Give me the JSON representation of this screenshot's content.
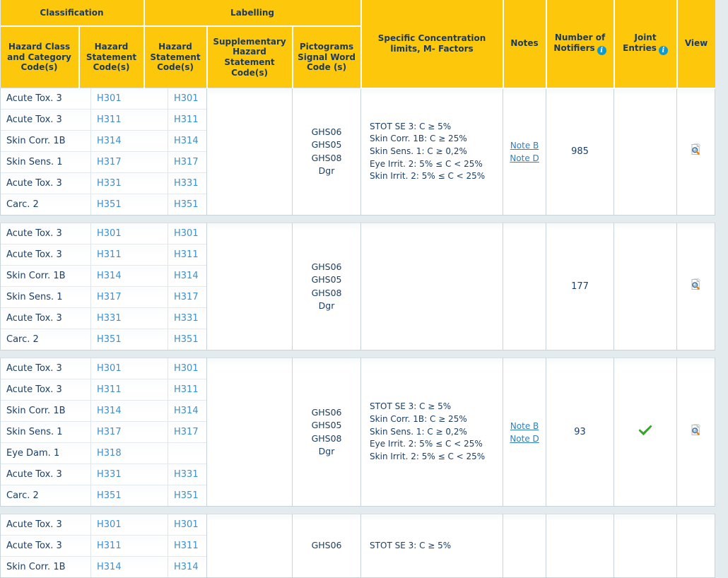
{
  "theme": {
    "header_bg": "#fdc70c",
    "header_text": "#1b3a5c",
    "page_bg": "#e4ebee",
    "link_color": "#3d8fce",
    "note_link_color": "#2f7fc1",
    "check_color": "#37a527",
    "info_icon_color": "#0e9ad4"
  },
  "header": {
    "group_classification": "Classification",
    "group_labelling": "Labelling",
    "columns": {
      "hazard_class_category": "Hazard Class and Category Code(s)",
      "hazard_statement_class": "Hazard Statement Code(s)",
      "hazard_statement_label": "Hazard Statement Code(s)",
      "supplementary": "Supplementary Hazard Statement Code(s)",
      "pictograms": "Pictograms Signal Word Code (s)",
      "specific_conc": "Specific Concentration limits, M- Factors",
      "notes": "Notes",
      "number_of_notifiers": "Number of Notifiers",
      "joint_entries": "Joint Entries",
      "view": "View"
    },
    "info_glyph": "i"
  },
  "icons": {
    "view": "view-document-icon",
    "joint_check": "green-check-icon",
    "info": "info-icon"
  },
  "groups": [
    {
      "id": "group-1",
      "rows": [
        {
          "hazard_class": "Acute Tox. 3",
          "hsc_class": "H301",
          "hsc_label": "H301"
        },
        {
          "hazard_class": "Acute Tox. 3",
          "hsc_class": "H311",
          "hsc_label": "H311"
        },
        {
          "hazard_class": "Skin Corr. 1B",
          "hsc_class": "H314",
          "hsc_label": "H314"
        },
        {
          "hazard_class": "Skin Sens. 1",
          "hsc_class": "H317",
          "hsc_label": "H317"
        },
        {
          "hazard_class": "Acute Tox. 3",
          "hsc_class": "H331",
          "hsc_label": "H331"
        },
        {
          "hazard_class": "Carc. 2",
          "hsc_class": "H351",
          "hsc_label": "H351"
        }
      ],
      "supplementary": "",
      "pictograms": "GHS06\nGHS05\nGHS08\nDgr",
      "specific_concentration": "STOT SE 3: C ≥ 5%\nSkin Corr. 1B: C ≥ 25%\nSkin Sens. 1: C ≥ 0,2%\nEye Irrit. 2: 5% ≤ C < 25%\nSkin Irrit. 2: 5% ≤ C < 25%",
      "notes": [
        "Note B",
        "Note D"
      ],
      "number_of_notifiers": "985",
      "joint_entries": false,
      "view": true
    },
    {
      "id": "group-2",
      "rows": [
        {
          "hazard_class": "Acute Tox. 3",
          "hsc_class": "H301",
          "hsc_label": "H301"
        },
        {
          "hazard_class": "Acute Tox. 3",
          "hsc_class": "H311",
          "hsc_label": "H311"
        },
        {
          "hazard_class": "Skin Corr. 1B",
          "hsc_class": "H314",
          "hsc_label": "H314"
        },
        {
          "hazard_class": "Skin Sens. 1",
          "hsc_class": "H317",
          "hsc_label": "H317"
        },
        {
          "hazard_class": "Acute Tox. 3",
          "hsc_class": "H331",
          "hsc_label": "H331"
        },
        {
          "hazard_class": "Carc. 2",
          "hsc_class": "H351",
          "hsc_label": "H351"
        }
      ],
      "supplementary": "",
      "pictograms": "GHS06\nGHS05\nGHS08\nDgr",
      "specific_concentration": "",
      "notes": [],
      "number_of_notifiers": "177",
      "joint_entries": false,
      "view": true
    },
    {
      "id": "group-3",
      "rows": [
        {
          "hazard_class": "Acute Tox. 3",
          "hsc_class": "H301",
          "hsc_label": "H301"
        },
        {
          "hazard_class": "Acute Tox. 3",
          "hsc_class": "H311",
          "hsc_label": "H311"
        },
        {
          "hazard_class": "Skin Corr. 1B",
          "hsc_class": "H314",
          "hsc_label": "H314"
        },
        {
          "hazard_class": "Skin Sens. 1",
          "hsc_class": "H317",
          "hsc_label": "H317"
        },
        {
          "hazard_class": "Eye Dam. 1",
          "hsc_class": "H318",
          "hsc_label": ""
        },
        {
          "hazard_class": "Acute Tox. 3",
          "hsc_class": "H331",
          "hsc_label": "H331"
        },
        {
          "hazard_class": "Carc. 2",
          "hsc_class": "H351",
          "hsc_label": "H351"
        }
      ],
      "supplementary": "",
      "pictograms": "GHS06\nGHS05\nGHS08\nDgr",
      "specific_concentration": "STOT SE 3: C ≥ 5%\nSkin Corr. 1B: C ≥ 25%\nSkin Sens. 1: C ≥ 0,2%\nEye Irrit. 2: 5% ≤ C < 25%\nSkin Irrit. 2: 5% ≤ C < 25%",
      "notes": [
        "Note B",
        "Note D"
      ],
      "number_of_notifiers": "93",
      "joint_entries": true,
      "view": true
    },
    {
      "id": "group-4",
      "rows": [
        {
          "hazard_class": "Acute Tox. 3",
          "hsc_class": "H301",
          "hsc_label": "H301"
        },
        {
          "hazard_class": "Acute Tox. 3",
          "hsc_class": "H311",
          "hsc_label": "H311"
        },
        {
          "hazard_class": "Skin Corr. 1B",
          "hsc_class": "H314",
          "hsc_label": "H314"
        }
      ],
      "supplementary": "",
      "pictograms": "GHS06",
      "specific_concentration": "STOT SE 3: C ≥ 5%",
      "notes": [],
      "number_of_notifiers": "",
      "joint_entries": false,
      "view": false
    }
  ]
}
